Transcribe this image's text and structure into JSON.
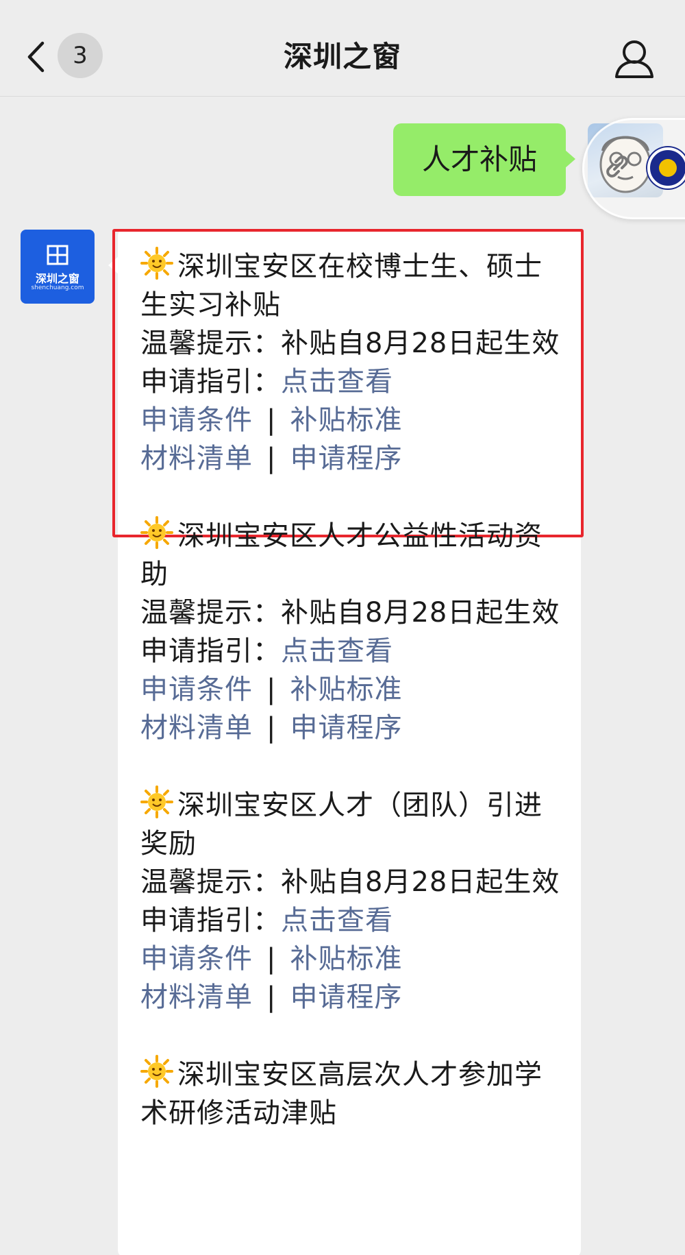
{
  "nav": {
    "badge_count": "3",
    "title": "深圳之窗"
  },
  "chat": {
    "outgoing": {
      "text": "人才补贴"
    },
    "brand_avatar": {
      "name": "深圳之窗",
      "url": "shenchuang.com"
    },
    "items": [
      {
        "title": "深圳宝安区在校博士生、硕士生实习补贴",
        "tip_label": "温馨提示：",
        "tip_text": "补贴自8月28日起生效",
        "guide_label": "申请指引：",
        "guide_link": "点击查看",
        "link_conditions": "申请条件",
        "link_standard": "补贴标准",
        "link_materials": "材料清单",
        "link_procedure": "申请程序"
      },
      {
        "title": "深圳宝安区人才公益性活动资助",
        "tip_label": "温馨提示：",
        "tip_text": "补贴自8月28日起生效",
        "guide_label": "申请指引：",
        "guide_link": "点击查看",
        "link_conditions": "申请条件",
        "link_standard": "补贴标准",
        "link_materials": "材料清单",
        "link_procedure": "申请程序"
      },
      {
        "title": "深圳宝安区人才（团队）引进奖励",
        "tip_label": "温馨提示：",
        "tip_text": "补贴自8月28日起生效",
        "guide_label": "申请指引：",
        "guide_link": "点击查看",
        "link_conditions": "申请条件",
        "link_standard": "补贴标准",
        "link_materials": "材料清单",
        "link_procedure": "申请程序"
      },
      {
        "title": "深圳宝安区高层次人才参加学术研修活动津贴"
      }
    ],
    "separator": "|"
  },
  "colors": {
    "background": "#ededed",
    "outgoing_bubble": "#95ec69",
    "link": "#576b95",
    "highlight": "#e8262d",
    "brand_blue": "#1d5fe0"
  },
  "icons": {
    "back": "chevron-left-icon",
    "profile": "person-icon",
    "sun": "sun-emoji-icon",
    "link": "link-icon"
  }
}
